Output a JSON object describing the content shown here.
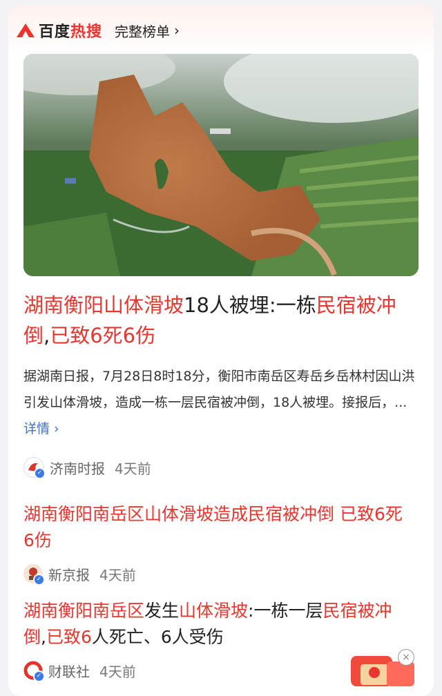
{
  "header": {
    "brand_prefix": "百度",
    "brand_hot": "热搜",
    "full_list_label": "完整榜单",
    "chevron": "›"
  },
  "hero": {
    "image_icon": "landslide-aerial-photo"
  },
  "article": {
    "headline_parts": [
      {
        "text": "湖南衡阳山体滑坡",
        "hl": true
      },
      {
        "text": "18人被埋:一栋",
        "hl": false
      },
      {
        "text": "民宿被冲倒",
        "hl": true
      },
      {
        "text": ",",
        "hl": false
      },
      {
        "text": "已致6死6伤",
        "hl": true
      }
    ],
    "summary": "据湖南日报，7月28日8时18分，衡阳市南岳区寿岳乡岳林村因山洪引发山体滑坡，造成一栋一层民宿被冲倒，18人被埋。接报后，...",
    "more_label": "详情 ›",
    "source": "济南时报",
    "time": "4天前"
  },
  "items": [
    {
      "title_parts": [
        {
          "text": "湖南衡阳南岳区山体滑坡造成民宿被冲倒 已致6死6伤",
          "hl": true
        }
      ],
      "source": "新京报",
      "time": "4天前"
    },
    {
      "title_parts": [
        {
          "text": "湖南衡阳南岳区",
          "hl": true
        },
        {
          "text": "发生",
          "hl": false
        },
        {
          "text": "山体滑坡",
          "hl": true
        },
        {
          "text": ":一栋一层",
          "hl": false
        },
        {
          "text": "民宿被冲倒",
          "hl": true
        },
        {
          "text": ",",
          "hl": false
        },
        {
          "text": "已致6",
          "hl": true
        },
        {
          "text": "人死亡、6人受伤",
          "hl": false
        }
      ],
      "source": "财联社",
      "time": "4天前"
    }
  ],
  "colors": {
    "accent": "#e8362f",
    "link": "#3f6fcc"
  },
  "close_symbol": "×"
}
